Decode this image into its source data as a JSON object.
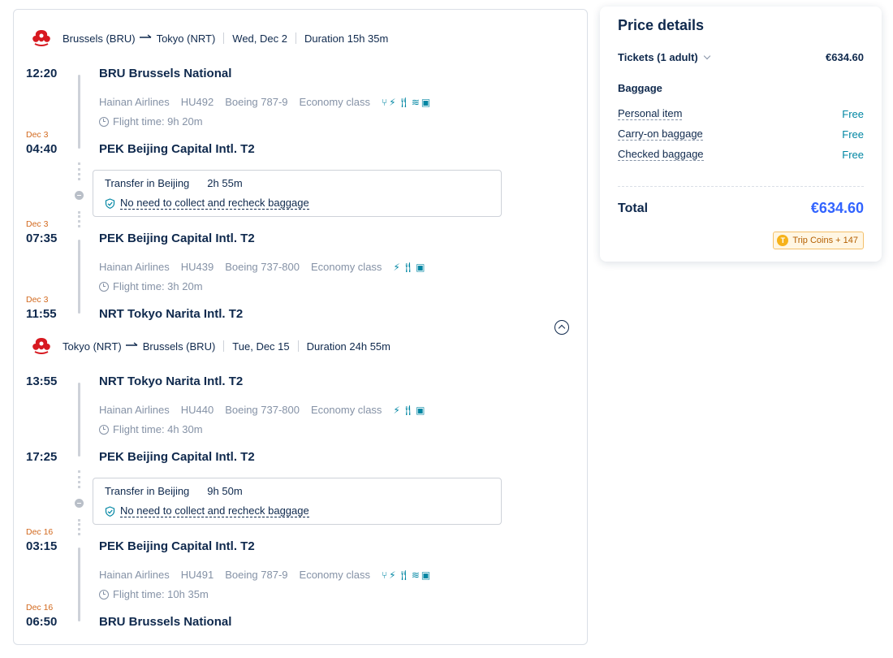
{
  "legs": [
    {
      "route_from": "Brussels (BRU)",
      "route_to": "Tokyo (NRT)",
      "date": "Wed, Dec 2",
      "duration": "Duration 15h 35m",
      "segments": [
        {
          "dep_time": "12:20",
          "dep_date": "",
          "dep_airport": "BRU Brussels National",
          "airline": "Hainan Airlines",
          "flight_no": "HU492",
          "aircraft": "Boeing 787-9",
          "cabin": "Economy class",
          "flight_time": "Flight time: 9h 20m",
          "arr_date": "Dec 3",
          "arr_time": "04:40",
          "arr_airport": "PEK Beijing Capital Intl. T2"
        },
        {
          "dep_date": "Dec 3",
          "dep_time": "07:35",
          "dep_airport": "PEK Beijing Capital Intl. T2",
          "airline": "Hainan Airlines",
          "flight_no": "HU439",
          "aircraft": "Boeing 737-800",
          "cabin": "Economy class",
          "flight_time": "Flight time: 3h 20m",
          "arr_date": "Dec 3",
          "arr_time": "11:55",
          "arr_airport": "NRT Tokyo Narita Intl. T2"
        }
      ],
      "transfer": {
        "label": "Transfer in Beijing",
        "duration": "2h 55m",
        "baggage_note": "No need to collect and recheck baggage"
      }
    },
    {
      "route_from": "Tokyo (NRT)",
      "route_to": "Brussels (BRU)",
      "date": "Tue, Dec 15",
      "duration": "Duration 24h 55m",
      "segments": [
        {
          "dep_time": "13:55",
          "dep_date": "",
          "dep_airport": "NRT Tokyo Narita Intl. T2",
          "airline": "Hainan Airlines",
          "flight_no": "HU440",
          "aircraft": "Boeing 737-800",
          "cabin": "Economy class",
          "flight_time": "Flight time: 4h 30m",
          "arr_date": "",
          "arr_time": "17:25",
          "arr_airport": "PEK Beijing Capital Intl. T2"
        },
        {
          "dep_date": "Dec 16",
          "dep_time": "03:15",
          "dep_airport": "PEK Beijing Capital Intl. T2",
          "airline": "Hainan Airlines",
          "flight_no": "HU491",
          "aircraft": "Boeing 787-9",
          "cabin": "Economy class",
          "flight_time": "Flight time: 10h 35m",
          "arr_date": "Dec 16",
          "arr_time": "06:50",
          "arr_airport": "BRU Brussels National"
        }
      ],
      "transfer": {
        "label": "Transfer in Beijing",
        "duration": "9h 50m",
        "baggage_note": "No need to collect and recheck baggage"
      }
    }
  ],
  "amenity_icons": {
    "long": [
      "seat-recline-icon",
      "power-icon",
      "meal-icon",
      "wifi-icon",
      "entertainment-icon"
    ],
    "short": [
      "power-icon",
      "meal-icon",
      "entertainment-icon"
    ]
  },
  "price": {
    "title": "Price details",
    "tickets_label": "Tickets (1 adult)",
    "tickets_value": "€634.60",
    "baggage_heading": "Baggage",
    "baggage": [
      {
        "label": "Personal item",
        "value": "Free"
      },
      {
        "label": "Carry-on baggage",
        "value": "Free"
      },
      {
        "label": "Checked baggage",
        "value": "Free"
      }
    ],
    "total_label": "Total",
    "total_value": "€634.60",
    "coins_label": "Trip Coins + 147"
  },
  "colors": {
    "accent_teal": "#0086a3",
    "total_blue": "#3264ff",
    "date_orange": "#d2691e",
    "text_dark": "#0f294d",
    "text_gray": "#8592a6"
  }
}
